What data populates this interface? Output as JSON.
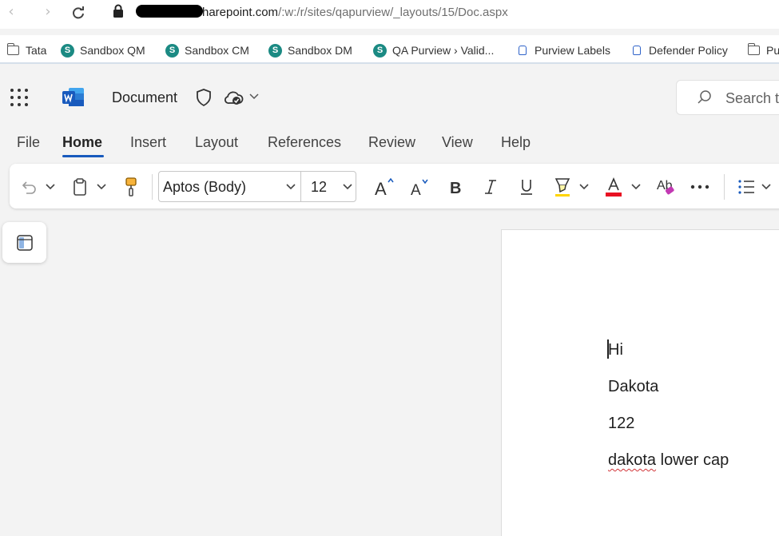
{
  "browser": {
    "url_host": "harepoint.com",
    "url_path": "/:w:/r/sites/qapurview/_layouts/15/Doc.aspx",
    "bookmarks": [
      {
        "label": "Tata",
        "icon": "folder-icon"
      },
      {
        "label": "Sandbox QM",
        "icon": "sharepoint-icon"
      },
      {
        "label": "Sandbox CM",
        "icon": "sharepoint-icon"
      },
      {
        "label": "Sandbox DM",
        "icon": "sharepoint-icon"
      },
      {
        "label": "QA Purview › Valid...",
        "icon": "sharepoint-icon"
      },
      {
        "label": "Purview Labels",
        "icon": "lock-icon"
      },
      {
        "label": "Defender Policy",
        "icon": "lock-icon"
      },
      {
        "label": "Pu",
        "icon": "folder-icon"
      }
    ]
  },
  "app": {
    "document_title": "Document",
    "search_placeholder": "Search t",
    "accent_color": "#185abd",
    "word_blue": "#2b579a"
  },
  "tabs": [
    "File",
    "Home",
    "Insert",
    "Layout",
    "References",
    "Review",
    "View",
    "Help"
  ],
  "active_tab": "Home",
  "ribbon": {
    "font_name": "Aptos (Body)",
    "font_size": "12",
    "font_color": "#e81123",
    "highlight_color": "#ffd400"
  },
  "document": {
    "lines": [
      "Hi",
      "Dakota",
      "122",
      "dakota lower cap"
    ],
    "misspelled_word": "dakota",
    "line_4_rest": " lower cap"
  }
}
